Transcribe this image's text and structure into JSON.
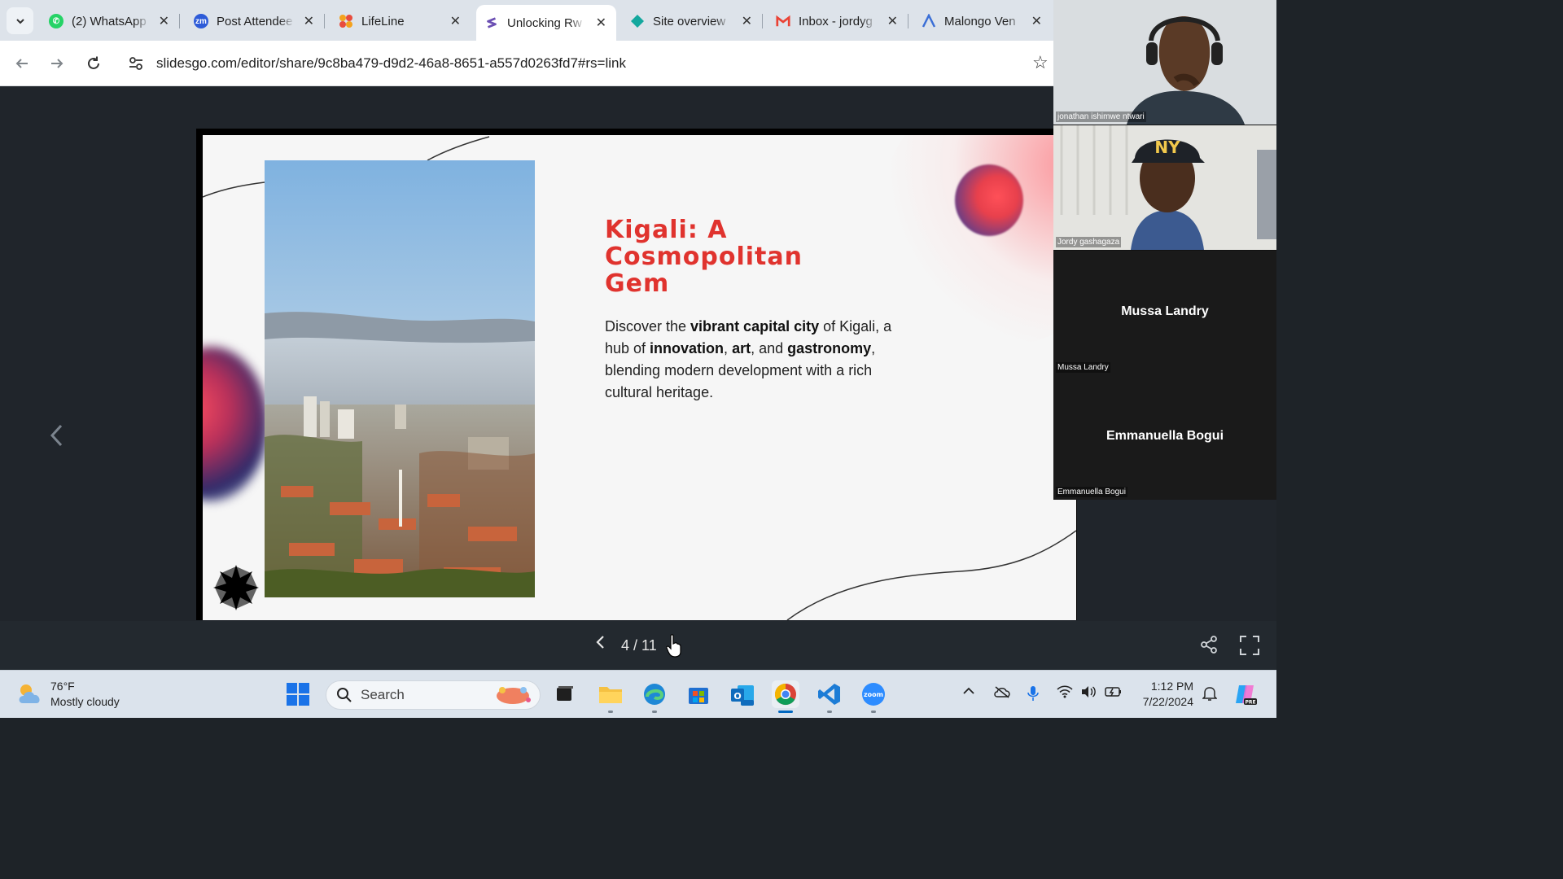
{
  "browser": {
    "tabs": [
      {
        "label": "(2) WhatsApp",
        "icon": "whatsapp-icon",
        "color": "#25d366"
      },
      {
        "label": "Post Attendee",
        "icon": "zoom-icon",
        "color": "#2d5bd8"
      },
      {
        "label": "LifeLine",
        "icon": "lifeline-icon",
        "color": "#f4a21d"
      },
      {
        "label": "Unlocking Rw",
        "icon": "slidesgo-icon",
        "color": "#6b4fb3",
        "active": true
      },
      {
        "label": "Site overview",
        "icon": "diamond-icon",
        "color": "#13a89e"
      },
      {
        "label": "Inbox - jordyg",
        "icon": "gmail-icon",
        "color": "#ea4335"
      },
      {
        "label": "Malongo Ven",
        "icon": "malongo-icon",
        "color": "#3b6fd6"
      }
    ],
    "url": "slidesgo.com/editor/share/9c8ba479-d9d2-46a8-8651-a557d0263fd7#rs=link"
  },
  "slide": {
    "title_lines": [
      "Kigali: A",
      "Cosmopolitan",
      "Gem"
    ],
    "body": {
      "p1": "Discover the ",
      "b1": "vibrant capital city",
      "p2": " of Kigali, a hub of ",
      "b2": "innovation",
      "p3": ", ",
      "b3": "art",
      "p4": ", and ",
      "b4": "gastronomy",
      "p5": ", blending modern development with a rich cultural heritage."
    },
    "accent_color": "#e0332e"
  },
  "controls": {
    "page": "4 / 11"
  },
  "participants": [
    {
      "name": "jonathan ishimwe ntwari",
      "video": true
    },
    {
      "name": "Jordy gashagaza",
      "video": true
    },
    {
      "name": "Mussa Landry",
      "video": false
    },
    {
      "name": "Emmanuella Bogui",
      "video": false
    }
  ],
  "taskbar": {
    "weather_temp": "76°F",
    "weather_desc": "Mostly cloudy",
    "search_label": "Search",
    "time": "1:12 PM",
    "date": "7/22/2024"
  }
}
